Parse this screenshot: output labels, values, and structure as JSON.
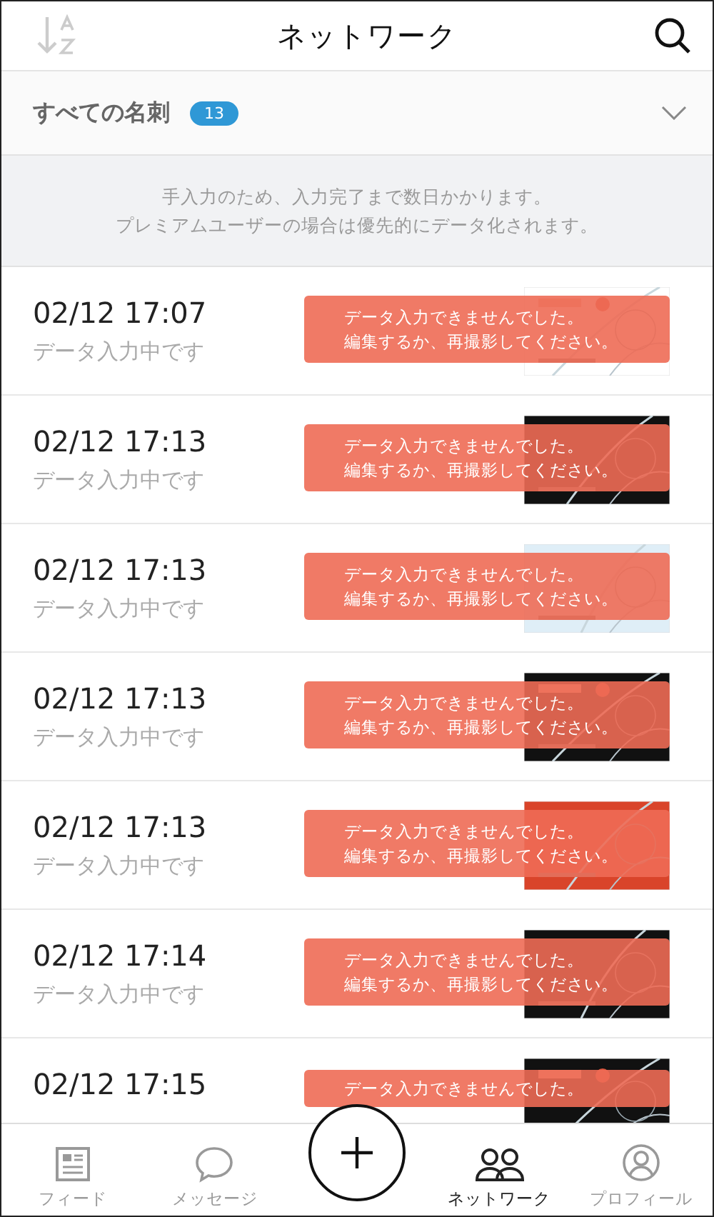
{
  "header": {
    "title": "ネットワーク"
  },
  "filter": {
    "label": "すべての名刺",
    "count": "13",
    "expanded": false
  },
  "notice": [
    "手入力のため、入力完了まで数日かかります。",
    "プレミアムユーザーの場合は優先的にデータ化されます。"
  ],
  "cards": [
    {
      "time": "02/12 17:07",
      "status": "データ入力中です",
      "error": [
        "データ入力できませんでした。",
        "編集するか、再撮影してください。"
      ]
    },
    {
      "time": "02/12 17:13",
      "status": "データ入力中です",
      "error": [
        "データ入力できませんでした。",
        "編集するか、再撮影してください。"
      ]
    },
    {
      "time": "02/12 17:13",
      "status": "データ入力中です",
      "error": [
        "データ入力できませんでした。",
        "編集するか、再撮影してください。"
      ]
    },
    {
      "time": "02/12 17:13",
      "status": "データ入力中です",
      "error": [
        "データ入力できませんでした。",
        "編集するか、再撮影してください。"
      ]
    },
    {
      "time": "02/12 17:13",
      "status": "データ入力中です",
      "error": [
        "データ入力できませんでした。",
        "編集するか、再撮影してください。"
      ]
    },
    {
      "time": "02/12 17:14",
      "status": "データ入力中です",
      "error": [
        "データ入力できませんでした。",
        "編集するか、再撮影してください。"
      ]
    },
    {
      "time": "02/12 17:15",
      "error": [
        "データ入力できませんでした。"
      ]
    }
  ],
  "tabs": [
    {
      "kind": "feed",
      "label": "フィード",
      "selected": false
    },
    {
      "kind": "message",
      "label": "メッセージ",
      "selected": false
    },
    {
      "kind": "add"
    },
    {
      "kind": "network",
      "label": "ネットワーク",
      "selected": true
    },
    {
      "kind": "profile",
      "label": "プロフィール",
      "selected": false
    }
  ]
}
